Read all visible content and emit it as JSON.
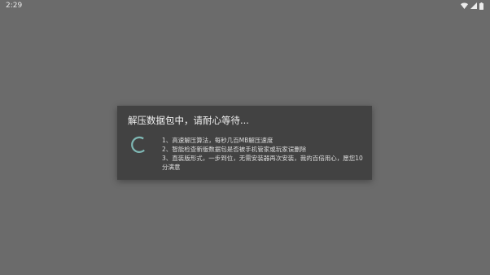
{
  "status_bar": {
    "time": "2:29",
    "icons": [
      "wifi-icon",
      "signal-icon",
      "battery-icon"
    ]
  },
  "dialog": {
    "title": "解压数据包中，请耐心等待...",
    "spinner_color": "#7fb8b4",
    "lines": [
      "1、高速解压算法，每秒几百MB解压速度",
      "2、智能检查新版数据包是否被手机管家或玩家误删除",
      "3、直装版形式，一步到位，无需安装器再次安装，我的百倍用心，愿您10分满意"
    ]
  },
  "colors": {
    "background": "#6b6b6b",
    "dialog_background": "#424242",
    "text_primary": "#f2f2f2",
    "text_secondary": "#dedede"
  }
}
